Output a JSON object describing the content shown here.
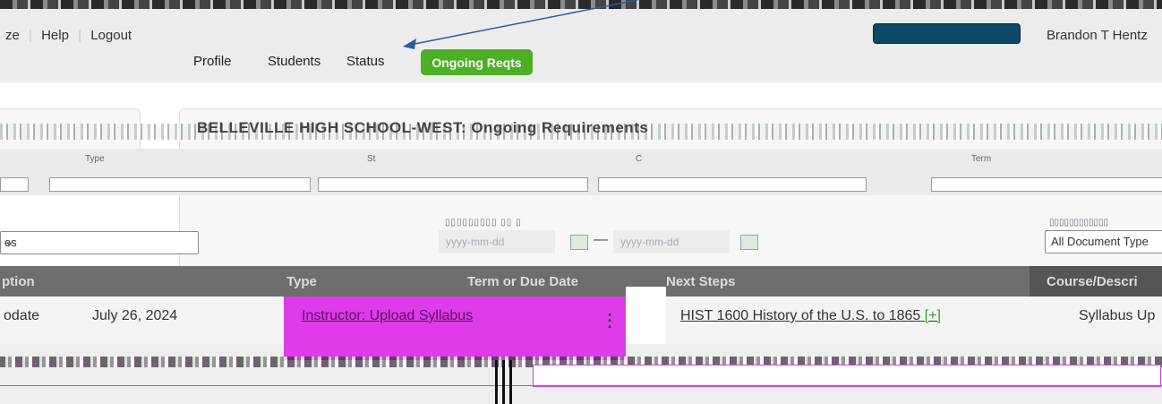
{
  "header": {
    "links": [
      "ze",
      "Help",
      "Logout"
    ],
    "user_name": "Brandon T Hentz",
    "nav": [
      "Profile",
      "Students",
      "Status",
      "Ongoing Reqts"
    ],
    "active_tab": "Ongoing Reqts",
    "active_color": "#4caf26",
    "search_color": "#0c4766"
  },
  "page": {
    "school_title": "BELLEVILLE HIGH SCHOOL-WEST: Ongoing Requirements"
  },
  "filters": {
    "type_label": "Type",
    "status_label": "St",
    "course_label": "C",
    "term_label": "Term",
    "left_select": "es",
    "date_placeholder_from": "yyyy-mm-dd",
    "date_placeholder_to": "yyyy-mm-dd",
    "date_separator": "—",
    "doc_select": "All Document Type"
  },
  "table": {
    "headers": [
      "ption",
      "Type",
      "Term or Due Date",
      "Next Steps",
      "Course/Descri"
    ],
    "rows": [
      {
        "col1": "odate",
        "date": "July 26, 2024",
        "type_link": "Instructor: Upload Syllabus",
        "next_step": "HIST 1600 History of the U.S. to 1865",
        "next_plus": "[+]",
        "desc": "Syllabus Up"
      }
    ],
    "highlight_color": "#dd3ce8"
  }
}
